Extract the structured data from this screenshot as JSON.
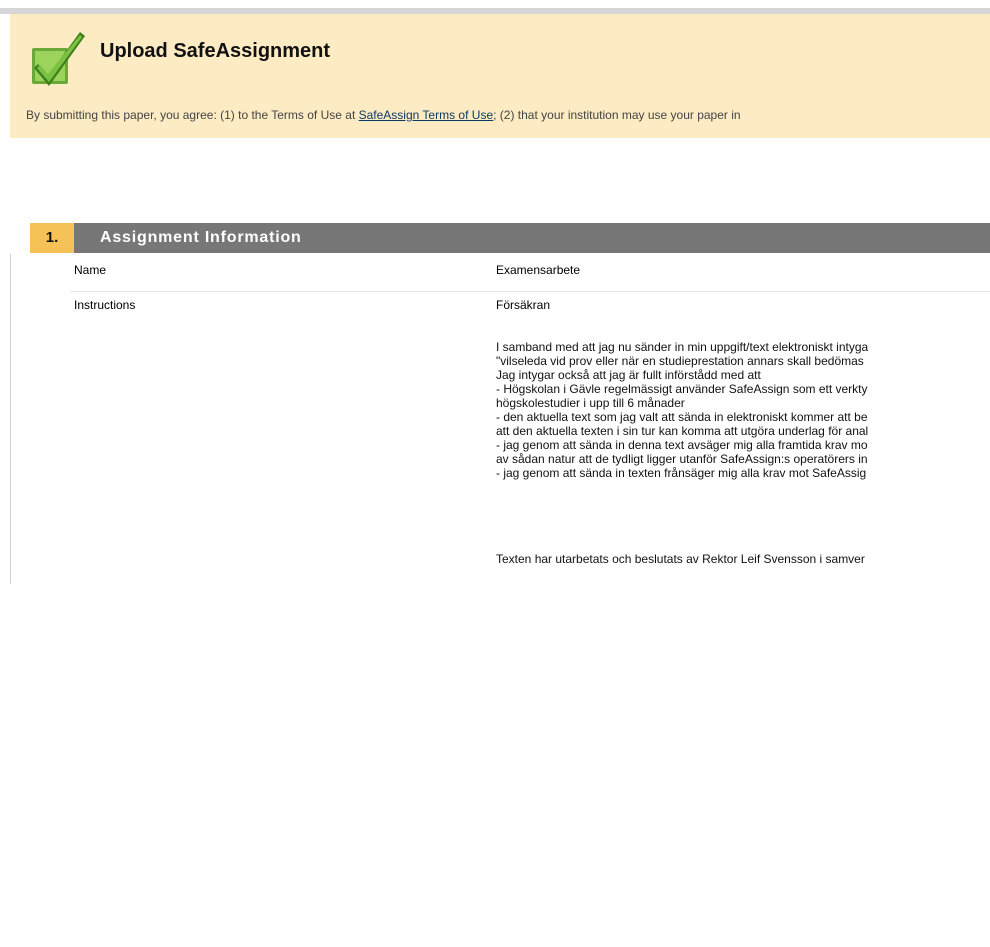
{
  "header": {
    "title": "Upload SafeAssignment",
    "notice_prefix": "By submitting this paper, you agree: (1) to the Terms of Use at ",
    "terms_link": "SafeAssign Terms of Use",
    "notice_suffix": "; (2) that your institution may use your paper in",
    "logo_icon": "green-checkmark-icon"
  },
  "step": {
    "number": "1.",
    "label": "Assignment Information"
  },
  "fields": {
    "name_label": "Name",
    "name_value": "Examensarbete",
    "instructions_label": "Instructions",
    "instructions_heading": "Försäkran",
    "instructions_lines": [
      "I samband med att jag nu sänder in min uppgift/text elektroniskt intyga",
      "\"vilseleda vid prov eller när en studieprestation annars skall bedömas",
      "Jag intygar också att jag är fullt införstådd med att",
      "- Högskolan i Gävle regelmässigt använder SafeAssign som ett verkty",
      "högskolestudier i upp till 6 månader",
      "- den aktuella text som jag valt att sända in elektroniskt kommer att be",
      "att den aktuella texten i sin tur kan komma att utgöra underlag för anal",
      "- jag genom att sända in denna text avsäger mig alla framtida krav mo",
      "av sådan natur att de tydligt ligger utanför SafeAssign:s operatörers in",
      "- jag genom att sända in texten frånsäger mig alla krav mot SafeAssig"
    ],
    "instructions_footer": "Texten har utarbetats och beslutats av Rektor Leif Svensson i samver"
  },
  "colors": {
    "header_bg": "#fdebc4",
    "step_number_bg": "#f6c257",
    "step_label_bg": "#777777",
    "link": "#0b3a66"
  }
}
